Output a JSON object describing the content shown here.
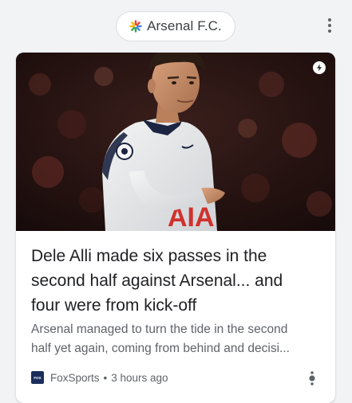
{
  "topic": {
    "label": "Arsenal F.C.",
    "icon": "google-spark-icon"
  },
  "overflow_menu": {
    "icon": "more-vert-icon"
  },
  "article": {
    "image": {
      "description": "photo-footballer",
      "shirt_text": "AIA",
      "badge_icon": "amp-lightning-icon"
    },
    "headline_lines": [
      "Dele Alli made six passes in the",
      "second half against Arsenal... and",
      "four were from kick-off"
    ],
    "snippet_lines": [
      "Arsenal managed to turn the tide in the second",
      "half yet again, coming from behind and decisi..."
    ],
    "source": "FoxSports",
    "source_logo_text": "FOX",
    "separator": "•",
    "time": "3 hours ago",
    "more_icon": "more-vert-icon"
  },
  "colors": {
    "background": "#f1f3f4",
    "card": "#ffffff",
    "headline": "#202124",
    "secondary_text": "#5f6368"
  }
}
